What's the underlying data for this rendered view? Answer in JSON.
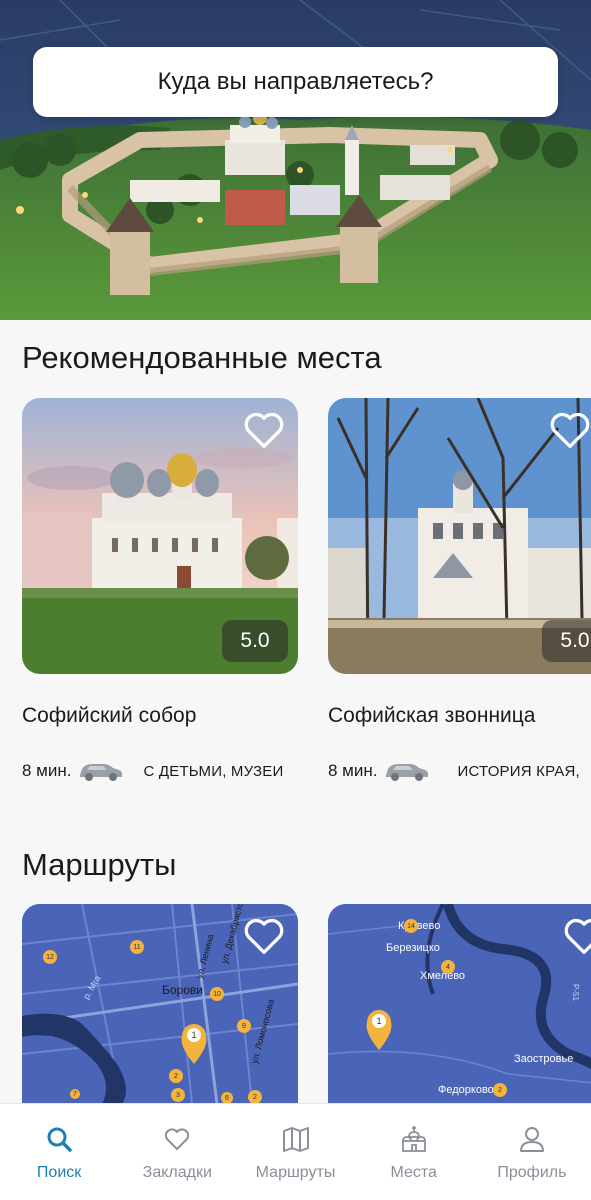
{
  "search": {
    "placeholder_text": "Куда вы направляетесь?"
  },
  "recommended": {
    "title": "Рекомендованные места",
    "places": [
      {
        "name": "Софийский собор",
        "rating": "5.0",
        "time": "8 мин.",
        "tags": "С ДЕТЬМИ, МУЗЕИ"
      },
      {
        "name": "Софийская звонница",
        "rating": "5.0",
        "time": "8 мин.",
        "tags": "ИСТОРИЯ КРАЯ,"
      }
    ]
  },
  "routes": {
    "title": "Маршруты",
    "map1_labels": {
      "town": "Борови",
      "street1": "ул. Ленина",
      "street2": "ул. Декабристов",
      "street3": "ул. Ломоносова",
      "river": "р. Мга"
    },
    "map1_pins": [
      "11",
      "12",
      "10",
      "9",
      "1",
      "2",
      "3",
      "7",
      "6",
      "2"
    ],
    "map2_labels": {
      "village1": "Кривево",
      "village2": "Березицко",
      "village3": "Хмелево",
      "village4": "Заостровье",
      "village5": "Федорково",
      "road": "Р-51"
    },
    "map2_pins": [
      "14",
      "4",
      "1",
      "2"
    ]
  },
  "bottom_nav": {
    "items": [
      {
        "label": "Поиск",
        "icon": "search-icon",
        "active": true
      },
      {
        "label": "Закладки",
        "icon": "heart-icon",
        "active": false
      },
      {
        "label": "Маршруты",
        "icon": "map-icon",
        "active": false
      },
      {
        "label": "Места",
        "icon": "church-icon",
        "active": false
      },
      {
        "label": "Профиль",
        "icon": "person-icon",
        "active": false
      }
    ]
  },
  "colors": {
    "accent": "#1e7fb0",
    "inactive": "#8a8f99",
    "map_blue": "#4a64b8",
    "pin": "#f2b43c"
  }
}
